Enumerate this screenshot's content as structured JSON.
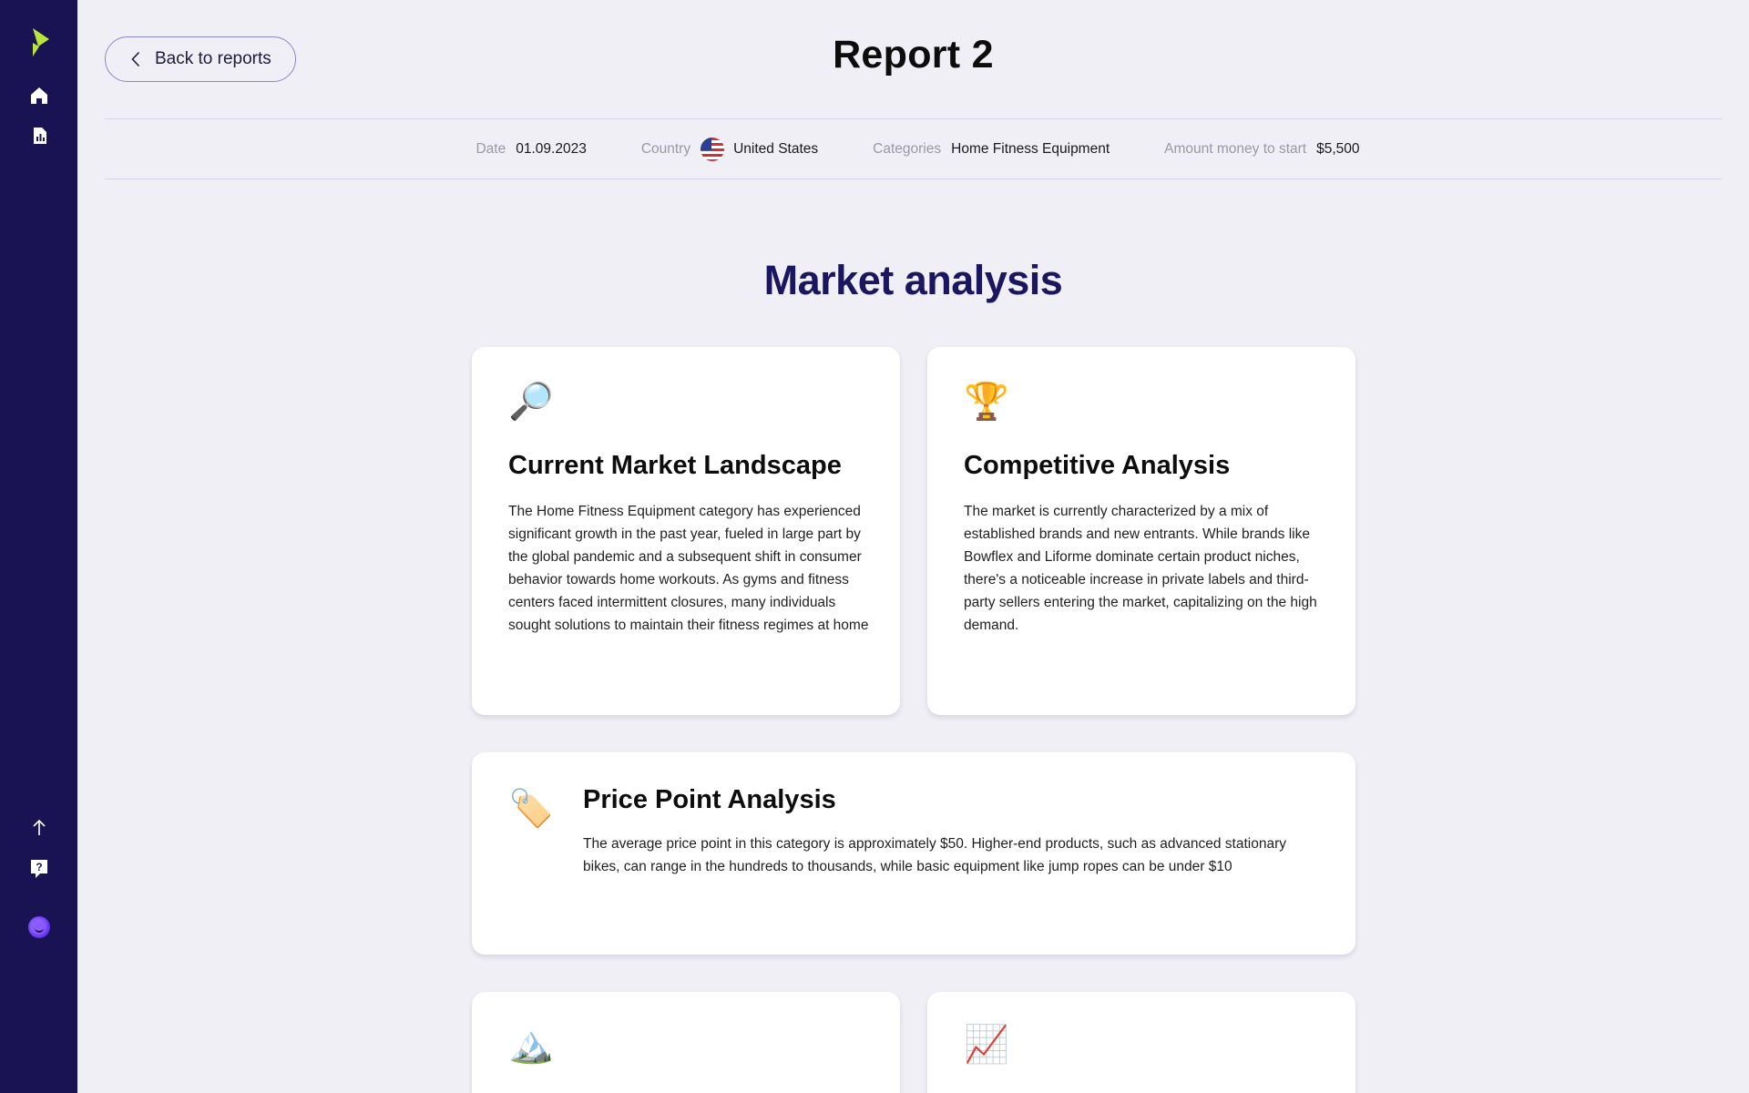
{
  "sidebar": {
    "items": [
      {
        "icon": "logo-icon"
      },
      {
        "icon": "home-icon"
      },
      {
        "icon": "reports-icon"
      },
      {
        "icon": "arrow-up-icon"
      },
      {
        "icon": "help-icon"
      },
      {
        "icon": "avatar"
      }
    ],
    "accent": "#b8e639",
    "background": "#1a1353"
  },
  "header": {
    "back_label": "Back to reports",
    "title": "Report 2"
  },
  "meta": {
    "date_label": "Date",
    "date_value": "01.09.2023",
    "country_label": "Country",
    "country_value": "United States",
    "categories_label": "Categories",
    "categories_value": "Home Fitness Equipment",
    "amount_label": "Amount money to start",
    "amount_value": "$5,500"
  },
  "section": {
    "title": "Market analysis"
  },
  "cards": [
    {
      "icon": "🔎",
      "title": "Current Market Landscape",
      "text": "The Home Fitness Equipment category has experienced significant growth in the past year, fueled in large part by the global pandemic and a subsequent shift in consumer behavior towards home workouts. As gyms and fitness centers faced intermittent closures, many individuals sought solutions to maintain their fitness regimes at home"
    },
    {
      "icon": "🏆",
      "title": "Competitive Analysis",
      "text": "The market is currently characterized by a mix of established brands and new entrants. While brands like Bowflex and Liforme dominate certain product niches, there's a noticeable increase in private labels and third-party sellers entering the market, capitalizing on the high demand."
    },
    {
      "icon": "🏷️",
      "title": "Price Point Analysis",
      "text": "The average price point in this category is approximately $50. Higher-end products, such as advanced stationary bikes, can range in the hundreds to thousands, while basic equipment like jump ropes can be under $10"
    },
    {
      "icon": "🏔️"
    },
    {
      "icon": "📈"
    }
  ]
}
